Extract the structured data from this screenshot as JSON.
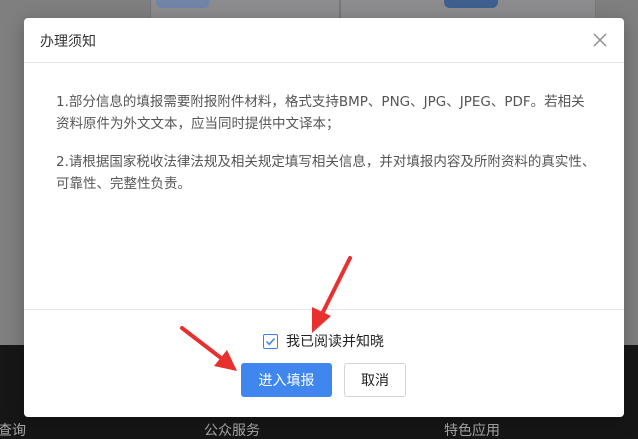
{
  "dialog": {
    "title": "办理须知",
    "paragraphs": [
      "1.部分信息的填报需要附报附件材料，格式支持BMP、PNG、JPG、JPEG、PDF。若相关资料原件为外文文本，应当同时提供中文译本；",
      "2.请根据国家税收法律法规及相关规定填写相关信息，并对填报内容及所附资料的真实性、可靠性、完整性负责。"
    ],
    "agree": {
      "label": "我已阅读并知晓",
      "checked": true
    },
    "buttons": {
      "confirm": "进入填报",
      "cancel": "取消"
    }
  },
  "background": {
    "footer_items": [
      "查询",
      "公众服务",
      "特色应用"
    ]
  },
  "colors": {
    "primary": "#3f87ef",
    "annotation": "#e8312f",
    "overlay": "#7f7f80",
    "footer": "#161616"
  },
  "icons": {
    "close": "close-icon",
    "checkbox": "checkmark-icon",
    "annotation": "arrow-icon"
  }
}
